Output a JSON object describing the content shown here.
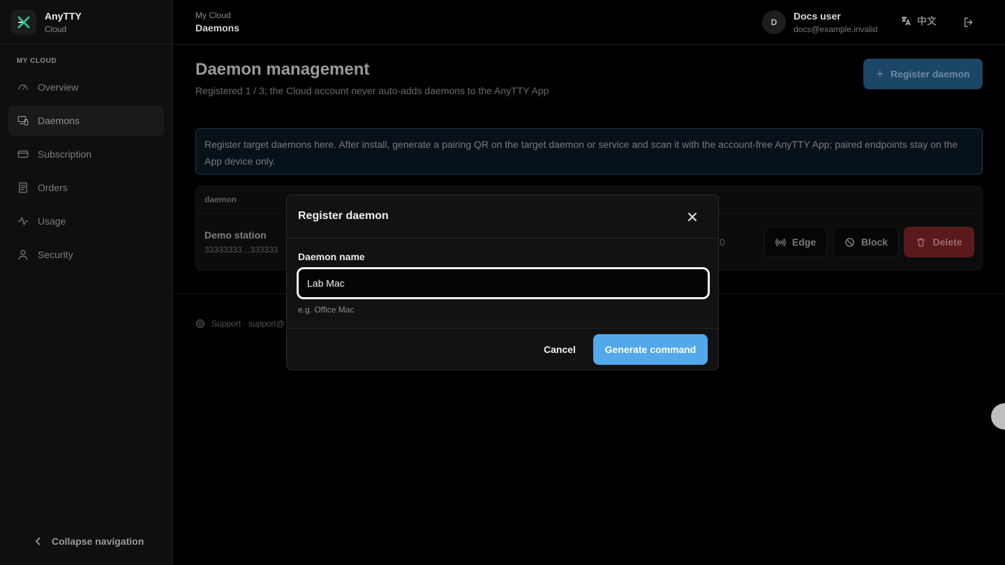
{
  "brand": {
    "name": "AnyTTY",
    "subtitle": "Cloud"
  },
  "sidebar": {
    "section_label": "MY CLOUD",
    "items": [
      {
        "label": "Overview",
        "icon": "gauge-icon",
        "active": false
      },
      {
        "label": "Daemons",
        "icon": "devices-icon",
        "active": true
      },
      {
        "label": "Subscription",
        "icon": "credit-card-icon",
        "active": false
      },
      {
        "label": "Orders",
        "icon": "receipt-icon",
        "active": false
      },
      {
        "label": "Usage",
        "icon": "activity-icon",
        "active": false
      },
      {
        "label": "Security",
        "icon": "user-icon",
        "active": false
      }
    ],
    "collapse_label": "Collapse navigation"
  },
  "header": {
    "breadcrumb_parent": "My Cloud",
    "breadcrumb_current": "Daemons",
    "user": {
      "initial": "D",
      "name": "Docs user",
      "email": "docs@example.invalid"
    },
    "language_label": "中文"
  },
  "main": {
    "title": "Daemon management",
    "subtitle": "Registered 1 / 3; the Cloud account never auto-adds daemons to the AnyTTY App",
    "register_button_label": "Register daemon",
    "info_text": "Register target daemons here. After install, generate a pairing QR on the target daemon or service and scan it with the account-free AnyTTY App; paired endpoints stay on the App device only.",
    "table": {
      "column_header": "daemon",
      "rows": [
        {
          "name": "Demo station",
          "id": "33333333…333333",
          "trailing": "0"
        }
      ],
      "actions": {
        "edge": "Edge",
        "block": "Block",
        "delete": "Delete"
      }
    },
    "support_text": "Support · support@"
  },
  "modal": {
    "title": "Register daemon",
    "field_label": "Daemon name",
    "field_value": "Lab Mac",
    "field_hint": "e.g. Office Mac",
    "cancel_label": "Cancel",
    "confirm_label": "Generate command"
  },
  "colors": {
    "accent": "#52a8ea",
    "danger": "#5a1a1a",
    "background": "#000000"
  }
}
